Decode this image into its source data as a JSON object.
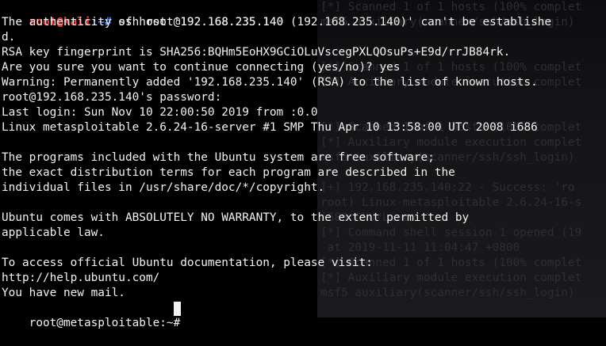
{
  "background_terminal": {
    "lines": [
      "[*] Scanned 1 of 1 hosts (100% complet",
      "msf5 auxiliary(scanner/ssh/ssh_login)",
      "",
      "",
      "[*] Scanned 1 of 1 hosts (100% complet",
      "[*] Auxiliary module execution complet",
      "",
      "",
      "[*] Scanned 1 of 1 hosts (100% complet",
      "[*] Auxiliary module execution complet",
      "msf5 auxiliary(scanner/ssh/ssh_login)",
      "",
      "[+] 192.168.235.140:22 - Success: 'ro",
      "root) Linux metasploitable 2.6.24-16-s",
      "i686 GNU/Linux '",
      "[*] Command shell session 1 opened (19",
      " at 2019-11-11 11:04:47 +0800",
      "[*] Scanned 1 of 1 hosts (100% complet",
      "[*] Auxiliary module execution complet",
      "msf5 auxiliary(scanner/ssh/ssh_login)"
    ]
  },
  "terminal": {
    "prompt_user_host": "root@kali",
    "prompt_path": ":~# ",
    "command": "ssh root@192.168.235.140",
    "output": [
      "The authenticity of host '192.168.235.140 (192.168.235.140)' can't be establishe",
      "d.",
      "RSA key fingerprint is SHA256:BQHm5EoHX9GCiOLuVscegPXLQOsuPs+E9d/rrJB84rk.",
      "Are you sure you want to continue connecting (yes/no)? yes",
      "Warning: Permanently added '192.168.235.140' (RSA) to the list of known hosts.",
      "root@192.168.235.140's password:",
      "Last login: Sun Nov 10 22:00:50 2019 from :0.0",
      "Linux metasploitable 2.6.24-16-server #1 SMP Thu Apr 10 13:58:00 UTC 2008 i686",
      "",
      "The programs included with the Ubuntu system are free software;",
      "the exact distribution terms for each program are described in the",
      "individual files in /usr/share/doc/*/copyright.",
      "",
      "Ubuntu comes with ABSOLUTELY NO WARRANTY, to the extent permitted by",
      "applicable law.",
      "",
      "To access official Ubuntu documentation, please visit:",
      "http://help.ubuntu.com/",
      "You have new mail."
    ],
    "final_prompt": "root@metasploitable:~# "
  }
}
